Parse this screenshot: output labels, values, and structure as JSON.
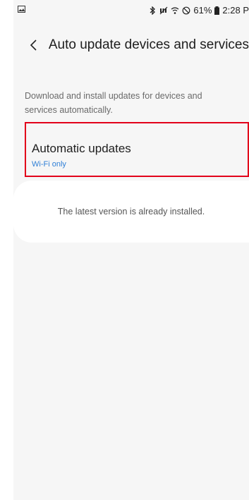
{
  "status_bar": {
    "battery_percent": "61%",
    "time": "2:28 P"
  },
  "header": {
    "title": "Auto update devices and services"
  },
  "description": "Download and install updates for devices and services automatically.",
  "automatic_updates": {
    "title": "Automatic updates",
    "value": "Wi-Fi only"
  },
  "status_message": "The latest version is already installed."
}
